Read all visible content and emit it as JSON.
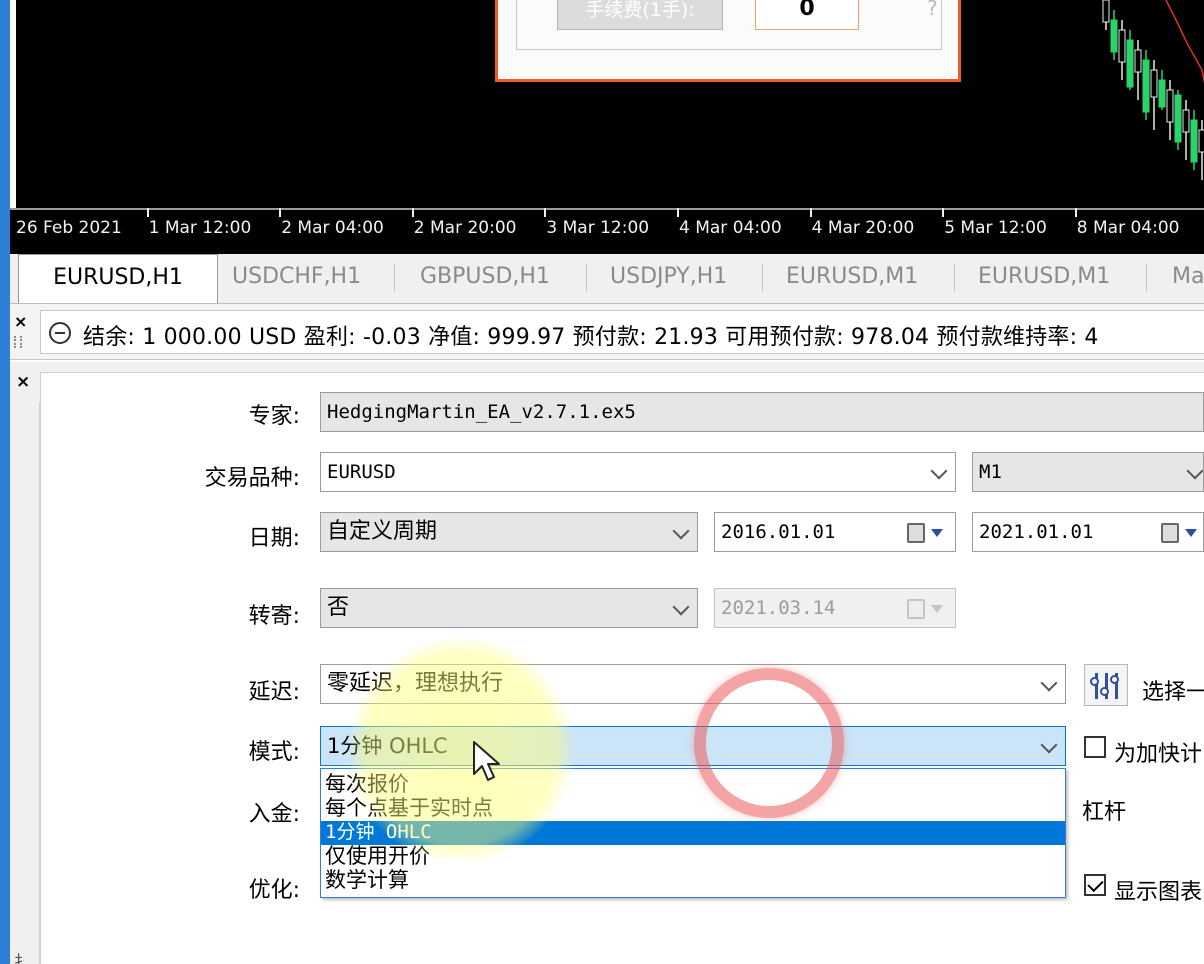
{
  "order_dialog": {
    "button_label": "手续费(1手):",
    "value": "0",
    "help": "?"
  },
  "chart": {
    "time_labels": [
      "26 Feb 2021",
      "1 Mar 12:00",
      "2 Mar 04:00",
      "2 Mar 20:00",
      "3 Mar 12:00",
      "4 Mar 04:00",
      "4 Mar 20:00",
      "5 Mar 12:00",
      "8 Mar 04:00"
    ],
    "colors": {
      "bull": "#2bd36b",
      "bear": "#e8e8e8",
      "ma": "#e0302a",
      "background": "#000000"
    }
  },
  "tabs": [
    "EURUSD,H1",
    "USDCHF,H1",
    "GBPUSD,H1",
    "USDJPY,H1",
    "EURUSD,M1",
    "EURUSD,M1",
    "Ma"
  ],
  "account": {
    "summary": "结余: 1 000.00 USD  盈利: -0.03  净值: 999.97  预付款: 21.93  可用预付款: 978.04  预付款维持率: 4"
  },
  "tester": {
    "expert_label": "专家:",
    "expert_value": "HedgingMartin_EA_v2.7.1.ex5",
    "symbol_label": "交易品种:",
    "symbol_value": "EURUSD",
    "timeframe_value": "M1",
    "date_label": "日期:",
    "period_value": "自定义周期",
    "date_from": "2016.01.01",
    "date_to": "2021.01.01",
    "forward_label": "转寄:",
    "forward_value": "否",
    "forward_date": "2021.03.14",
    "delay_label": "延迟:",
    "delay_value": "零延迟，理想执行",
    "select_text": "选择一",
    "mode_label": "模式:",
    "mode_value": "1分钟 OHLC",
    "mode_options": [
      "每次报价",
      "每个点基于实时点",
      "1分钟 OHLC",
      "仅使用开价",
      "数学计算"
    ],
    "deposit_label": "入金:",
    "leverage_label": "杠杆",
    "optimize_label": "优化:",
    "speed_checkbox_text": "为加快计",
    "show_chart_text": "显示图表"
  }
}
